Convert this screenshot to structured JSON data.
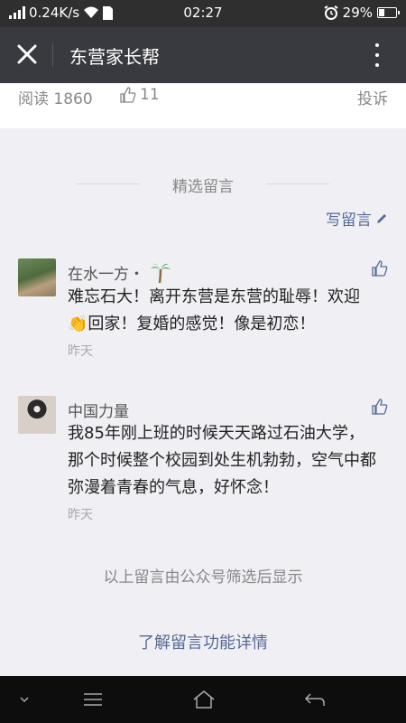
{
  "status_bar": {
    "speed": "0.24K/s",
    "time": "02:27",
    "battery": "29%",
    "battery_level": 0.29
  },
  "app_bar": {
    "title": "东营家长帮"
  },
  "article": {
    "read_label": "阅读 1860",
    "likes": "11",
    "report": "投诉"
  },
  "comments_section": {
    "title": "精选留言",
    "write_label": "写留言",
    "items": [
      {
        "nickname": "在水一方・",
        "text": "难忘石大！离开东营是东营的耻辱！欢迎👏回家！复婚的感觉！像是初恋！",
        "time": "昨天"
      },
      {
        "nickname": "中国力量",
        "text": "我85年刚上班的时候天天路过石油大学，那个时候整个校园到处生机勃勃，空气中都弥漫着青春的气息，好怀念！",
        "time": "昨天"
      }
    ],
    "filter_note": "以上留言由公众号筛选后显示",
    "learn_more": "了解留言功能详情"
  },
  "icons": {
    "close": "close-icon",
    "more": "more-vertical-icon",
    "thumb": "thumbs-up-icon",
    "pencil": "pencil-icon",
    "palm": "palm-tree-emoji",
    "clap": "clapping-hands-emoji",
    "nav_down": "chevron-down-icon",
    "nav_menu": "menu-icon",
    "nav_home": "home-icon",
    "nav_back": "back-icon"
  },
  "colors": {
    "app_bar": "#393a3f",
    "link": "#576b95",
    "background": "#efeff4"
  }
}
